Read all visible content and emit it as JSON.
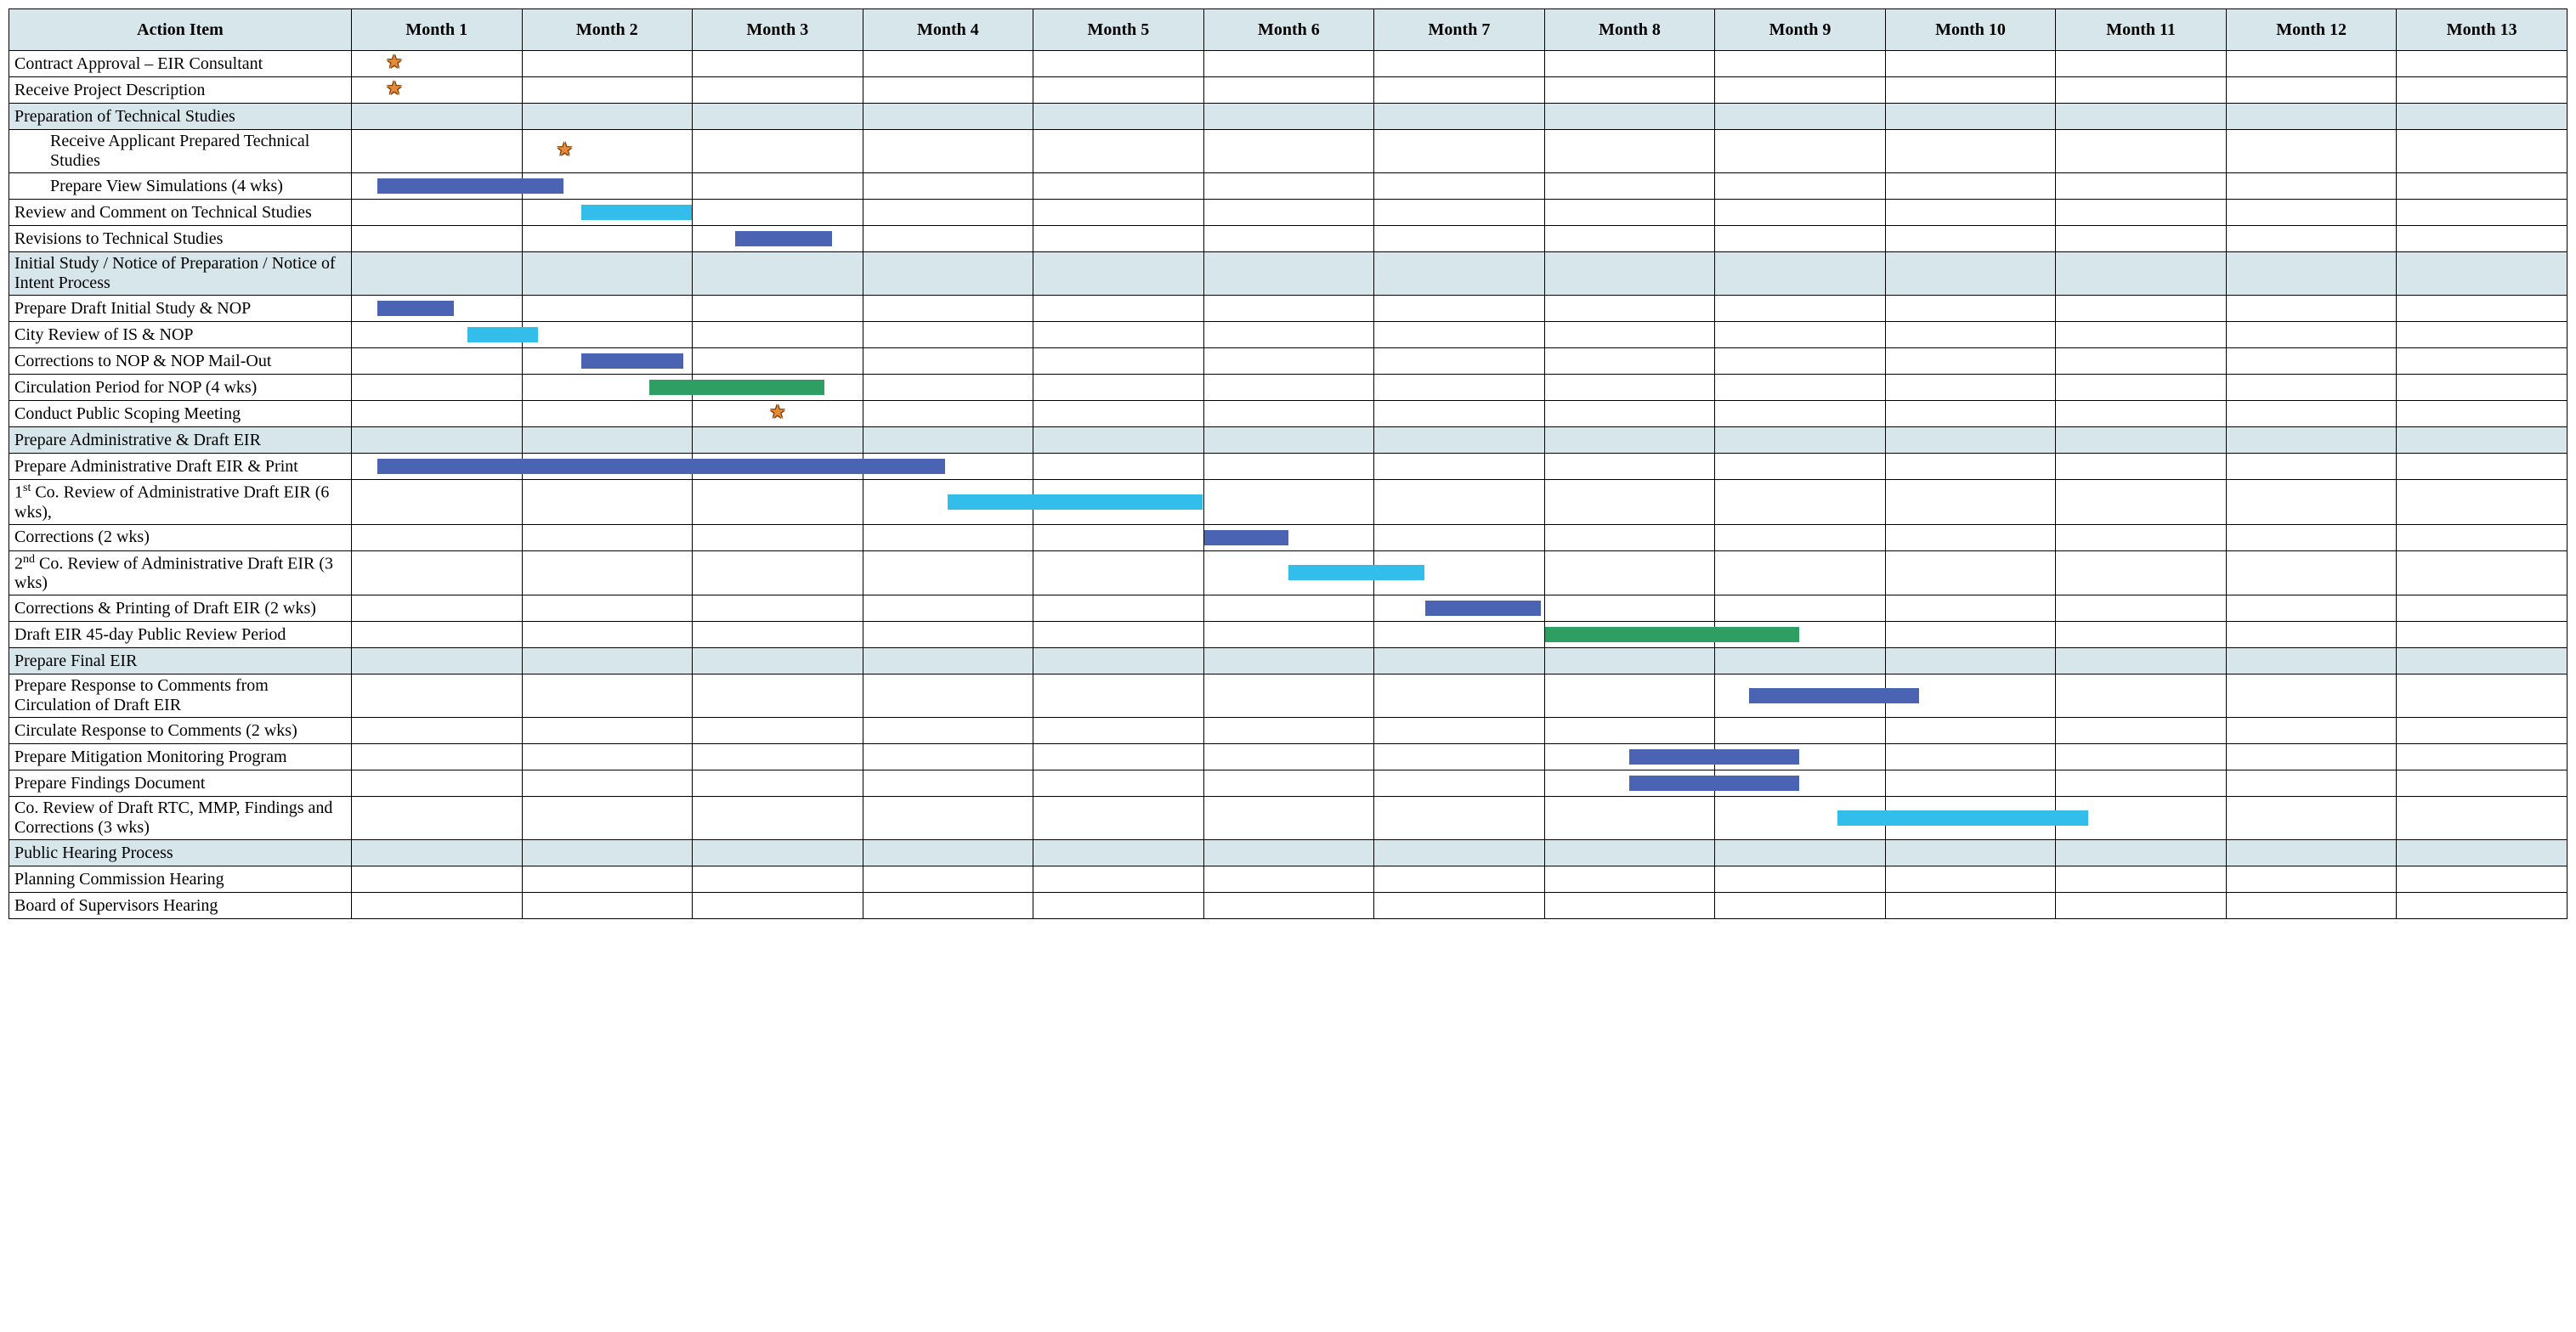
{
  "headers": {
    "action": "Action Item",
    "months": [
      "Month 1",
      "Month 2",
      "Month 3",
      "Month 4",
      "Month 5",
      "Month 6",
      "Month 7",
      "Month 8",
      "Month 9",
      "Month 10",
      "Month 11",
      "Month 12",
      "Month 13"
    ]
  },
  "colors": {
    "header_bg": "#d6e6ea",
    "bar_blue": "#4a63b3",
    "bar_cyan": "#33bdea",
    "bar_green": "#2f9e62",
    "star": "#e58a3a"
  },
  "chart_data": {
    "type": "gantt",
    "x_categories": [
      "Month 1",
      "Month 2",
      "Month 3",
      "Month 4",
      "Month 5",
      "Month 6",
      "Month 7",
      "Month 8",
      "Month 9",
      "Month 10",
      "Month 11",
      "Month 12",
      "Month 13"
    ],
    "rows": [
      {
        "label": "Contract Approval – EIR Consultant",
        "type": "task",
        "milestone": {
          "month": 1,
          "pos": 0.25
        }
      },
      {
        "label": "Receive Project Description",
        "type": "task",
        "milestone": {
          "month": 1,
          "pos": 0.25
        }
      },
      {
        "label": "Preparation of Technical Studies",
        "type": "section"
      },
      {
        "label": "Receive Applicant Prepared Technical Studies",
        "type": "task",
        "indent": 1,
        "milestone": {
          "month": 2,
          "pos": 0.25
        }
      },
      {
        "label": "Prepare View Simulations (4 wks)",
        "type": "task",
        "indent": 1,
        "bar": {
          "start": 1.15,
          "end": 2.25,
          "color": "blue"
        }
      },
      {
        "label": "Review and Comment on Technical Studies",
        "type": "task",
        "bar": {
          "start": 2.35,
          "end": 3.0,
          "color": "cyan"
        }
      },
      {
        "label": "Revisions to Technical Studies",
        "type": "task",
        "bar": {
          "start": 3.25,
          "end": 3.82,
          "color": "blue"
        }
      },
      {
        "label": "Initial Study / Notice of Preparation / Notice of Intent Process",
        "type": "section"
      },
      {
        "label": "Prepare Draft Initial Study & NOP",
        "type": "task",
        "bar": {
          "start": 1.15,
          "end": 1.6,
          "color": "blue"
        }
      },
      {
        "label": "City Review of IS & NOP",
        "type": "task",
        "bar": {
          "start": 1.68,
          "end": 2.1,
          "color": "cyan"
        }
      },
      {
        "label": "Corrections to NOP & NOP Mail-Out",
        "type": "task",
        "bar": {
          "start": 2.35,
          "end": 2.95,
          "color": "blue"
        }
      },
      {
        "label": "Circulation Period for NOP  (4 wks)",
        "type": "task",
        "bar": {
          "start": 2.75,
          "end": 3.78,
          "color": "green"
        }
      },
      {
        "label": "Conduct Public Scoping Meeting",
        "type": "task",
        "milestone": {
          "month": 3,
          "pos": 0.5
        }
      },
      {
        "label": "Prepare Administrative & Draft EIR",
        "type": "section"
      },
      {
        "label": "Prepare Administrative Draft EIR & Print",
        "type": "task",
        "bar": {
          "start": 1.15,
          "end": 4.5,
          "color": "blue"
        }
      },
      {
        "label": "1st Co. Review of Administrative Draft EIR (6 wks),",
        "type": "task",
        "sup": "st",
        "bar": {
          "start": 4.5,
          "end": 6.0,
          "color": "cyan"
        }
      },
      {
        "label": "Corrections (2 wks)",
        "type": "task",
        "bar": {
          "start": 6.0,
          "end": 6.5,
          "color": "blue"
        }
      },
      {
        "label": "2nd Co. Review of Administrative Draft EIR (3 wks)",
        "type": "task",
        "sup": "nd",
        "bar": {
          "start": 6.5,
          "end": 7.3,
          "color": "cyan"
        }
      },
      {
        "label": "Corrections & Printing of Draft EIR (2 wks)",
        "type": "task",
        "bar": {
          "start": 7.3,
          "end": 7.98,
          "color": "blue"
        }
      },
      {
        "label": "Draft EIR 45-day Public Review Period",
        "type": "task",
        "bar": {
          "start": 8.0,
          "end": 9.5,
          "color": "green"
        }
      },
      {
        "label": "Prepare Final EIR",
        "type": "section"
      },
      {
        "label": "Prepare Response to Comments from Circulation of Draft EIR",
        "type": "task",
        "bar": {
          "start": 9.2,
          "end": 10.2,
          "color": "blue"
        }
      },
      {
        "label": "Circulate Response to Comments (2 wks)",
        "type": "task"
      },
      {
        "label": "Prepare Mitigation Monitoring Program",
        "type": "task",
        "bar": {
          "start": 8.5,
          "end": 9.5,
          "color": "blue"
        }
      },
      {
        "label": "Prepare Findings Document",
        "type": "task",
        "bar": {
          "start": 8.5,
          "end": 9.5,
          "color": "blue"
        }
      },
      {
        "label": "Co. Review of Draft RTC, MMP, Findings and Corrections (3 wks)",
        "type": "task",
        "bar": {
          "start": 9.72,
          "end": 11.2,
          "color": "cyan"
        }
      },
      {
        "label": "Public Hearing Process",
        "type": "section"
      },
      {
        "label": "Planning Commission Hearing",
        "type": "task"
      },
      {
        "label": "Board of Supervisors Hearing",
        "type": "task"
      }
    ]
  }
}
